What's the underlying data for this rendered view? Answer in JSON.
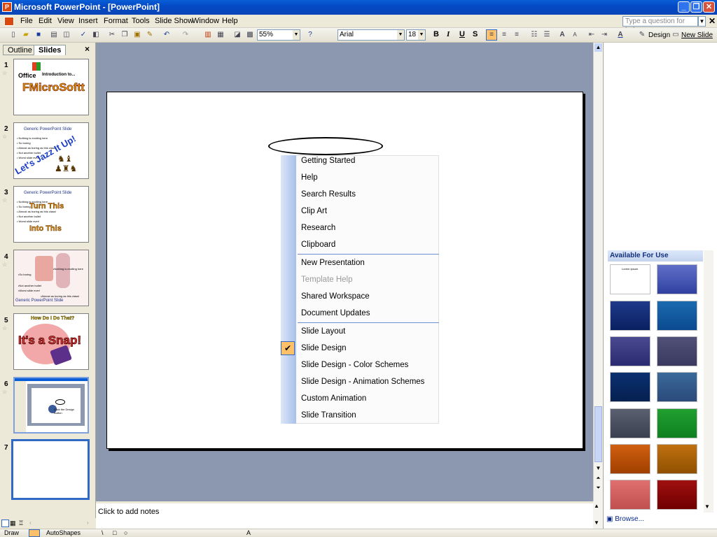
{
  "window": {
    "title": "Microsoft PowerPoint - [PowerPoint]"
  },
  "menubar": {
    "items": [
      "File",
      "Edit",
      "View",
      "Insert",
      "Format",
      "Tools",
      "Slide Show",
      "Window",
      "Help"
    ],
    "help_placeholder": "Type a question for help"
  },
  "toolbar": {
    "zoom": "55%",
    "font": "Arial",
    "size": "18",
    "bold": "B",
    "italic": "I",
    "underline": "U",
    "shadow": "S",
    "design": "Design",
    "new_slide": "New Slide"
  },
  "leftpane": {
    "tabs": [
      "Outline",
      "Slides"
    ],
    "close": "×",
    "slide_numbers": [
      "1",
      "2",
      "3",
      "4",
      "5",
      "6",
      "7"
    ],
    "thumbs": {
      "s1": {
        "a": "Office",
        "b": "Introduction to...",
        "c": "FMicroSoftt"
      },
      "s2": {
        "a": "Generic PowerPoint Slide",
        "b": "Let's Jazz It Up!",
        "c": "• Nothing is exciting here\n• So boring\n• Almost as boring as this class!\n• Not another bullet\n• Worst slide ever"
      },
      "s3": {
        "a": "Generic PowerPoint Slide",
        "b": "Turn This",
        "c": "Into This",
        "d": "• Nothing is exciting here\n• So boring\n• Almost as boring as this class!\n• Not another bullet\n• Worst slide ever!"
      },
      "s4": {
        "a": "•Nothing is exciting here",
        "b": "•So boring",
        "c": "•Not another bullet",
        "d": "•Worst slide ever!",
        "e": "•Almost as boring as this class!",
        "f": "Generic PowerPoint Slide"
      },
      "s5": {
        "a": "How Do I Do That?",
        "b": "It's a Snap!"
      },
      "s6": {
        "a": "Click the Design Button"
      }
    }
  },
  "notes": {
    "placeholder": "Click to add notes"
  },
  "taskpane": {
    "header": "Available For Use",
    "browse": "Browse...",
    "template_title": "Lorem Ipsum"
  },
  "context_menu": {
    "group1": [
      "Getting Started",
      "Help",
      "Search Results",
      "Clip Art",
      "Research",
      "Clipboard"
    ],
    "group2": [
      "New Presentation",
      "Template Help",
      "Shared Workspace",
      "Document Updates"
    ],
    "group3": [
      "Slide Layout",
      "Slide Design",
      "Slide Design - Color Schemes",
      "Slide Design - Animation Schemes",
      "Custom Animation",
      "Slide Transition"
    ],
    "checked_item": "Slide Design",
    "disabled_item": "Template Help"
  },
  "drawbar": {
    "draw": "Draw",
    "autoshapes": "AutoShapes"
  },
  "colors": {
    "titlebar": "#0a5fd8",
    "workarea": "#8c98b0",
    "menu_highlight": "#ffc06a",
    "accent": "#316ac5"
  }
}
